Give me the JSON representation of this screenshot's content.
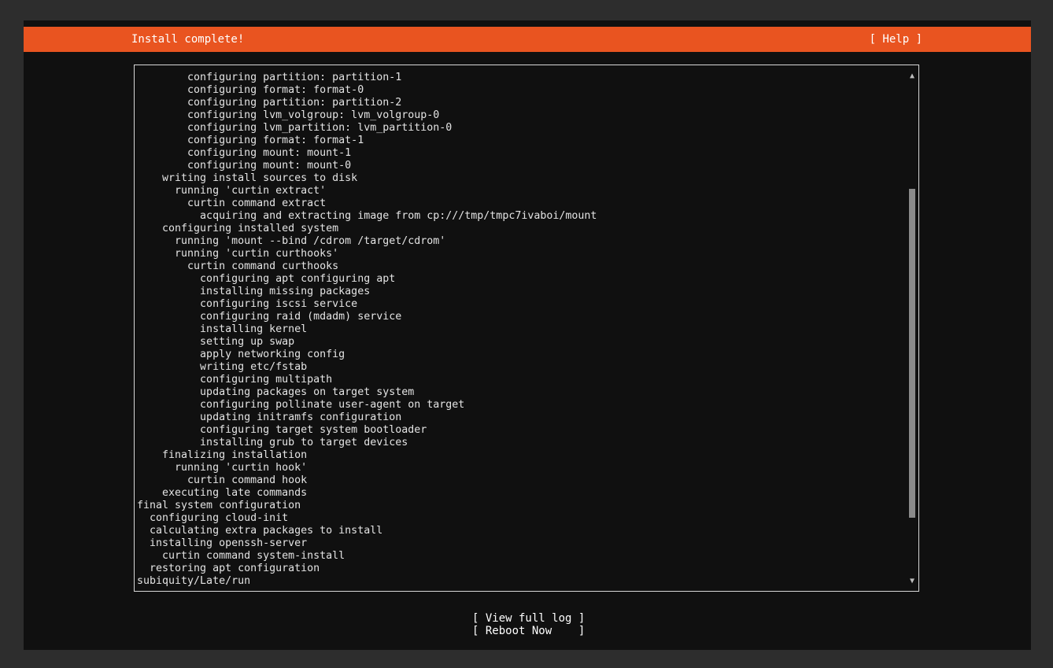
{
  "header": {
    "title": "Install complete!",
    "help_label": "[ Help ]"
  },
  "log": {
    "lines": [
      "        configuring partition: partition-1",
      "        configuring format: format-0",
      "        configuring partition: partition-2",
      "        configuring lvm_volgroup: lvm_volgroup-0",
      "        configuring lvm_partition: lvm_partition-0",
      "        configuring format: format-1",
      "        configuring mount: mount-1",
      "        configuring mount: mount-0",
      "    writing install sources to disk",
      "      running 'curtin extract'",
      "        curtin command extract",
      "          acquiring and extracting image from cp:///tmp/tmpc7ivaboi/mount",
      "    configuring installed system",
      "      running 'mount --bind /cdrom /target/cdrom'",
      "      running 'curtin curthooks'",
      "        curtin command curthooks",
      "          configuring apt configuring apt",
      "          installing missing packages",
      "          configuring iscsi service",
      "          configuring raid (mdadm) service",
      "          installing kernel",
      "          setting up swap",
      "          apply networking config",
      "          writing etc/fstab",
      "          configuring multipath",
      "          updating packages on target system",
      "          configuring pollinate user-agent on target",
      "          updating initramfs configuration",
      "          configuring target system bootloader",
      "          installing grub to target devices",
      "    finalizing installation",
      "      running 'curtin hook'",
      "        curtin command hook",
      "    executing late commands",
      "final system configuration",
      "  configuring cloud-init",
      "  calculating extra packages to install",
      "  installing openssh-server",
      "    curtin command system-install",
      "  restoring apt configuration",
      "subiquity/Late/run"
    ],
    "scroll_up_glyph": "▲",
    "scroll_down_glyph": "▼",
    "scroll_position": 0.65
  },
  "actions": {
    "view_log_label": "[ View full log ]",
    "reboot_label": "[ Reboot Now    ]"
  },
  "colors": {
    "accent": "#e95420",
    "background": "#101010",
    "text": "#e4e4e4"
  }
}
